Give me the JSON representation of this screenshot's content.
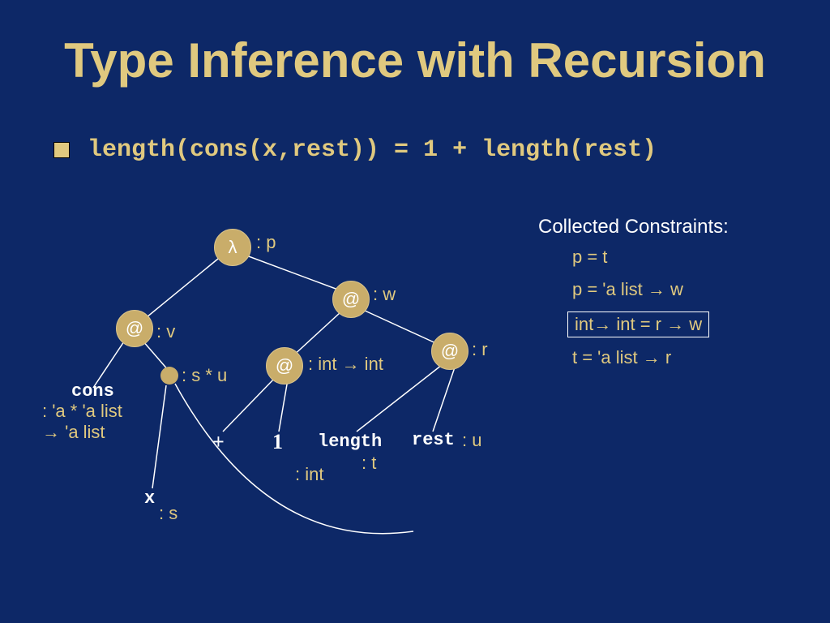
{
  "title": "Type Inference with Recursion",
  "bullet": "length(cons(x,rest)) = 1 + length(rest)",
  "nodes": {
    "lambda": {
      "sym": "λ",
      "type": ": p"
    },
    "apV": {
      "sym": "@",
      "type": ": v"
    },
    "apW": {
      "sym": "@",
      "type": ": w"
    },
    "apInt": {
      "sym": "@",
      "type": ": int → int"
    },
    "apR": {
      "sym": "@",
      "type": ": r"
    },
    "pair": {
      "type": ": s * u"
    }
  },
  "leaves": {
    "cons": {
      "label": "cons",
      "type": ": 'a * 'a list\n→ 'a list"
    },
    "x": {
      "label": "x",
      "type": ": s"
    },
    "plus": {
      "label": "+"
    },
    "one": {
      "label": "1",
      "type": ": int"
    },
    "length": {
      "label": "length",
      "type": ": t"
    },
    "rest": {
      "label": "rest",
      "type": ": u"
    }
  },
  "constraints": {
    "title": "Collected Constraints:",
    "items": [
      "p = t",
      "p = 'a list → w",
      "int→ int = r → w",
      "t = 'a list → r"
    ],
    "boxed_index": 2
  }
}
